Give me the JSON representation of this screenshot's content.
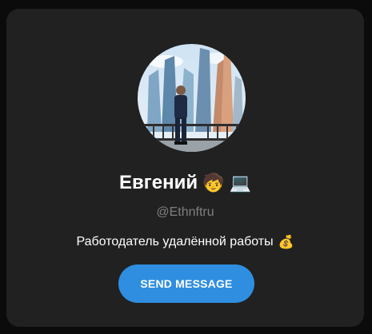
{
  "profile": {
    "name": "Евгений",
    "name_emojis": [
      "🧒",
      "💻"
    ],
    "username": "@Ethnftru",
    "bio": "Работодатель удалённой работы",
    "bio_emoji": "💰"
  },
  "actions": {
    "send_message_label": "SEND MESSAGE"
  },
  "colors": {
    "card_bg": "#212121",
    "button_bg": "#2f8ee0",
    "username": "#7f7f7f"
  }
}
